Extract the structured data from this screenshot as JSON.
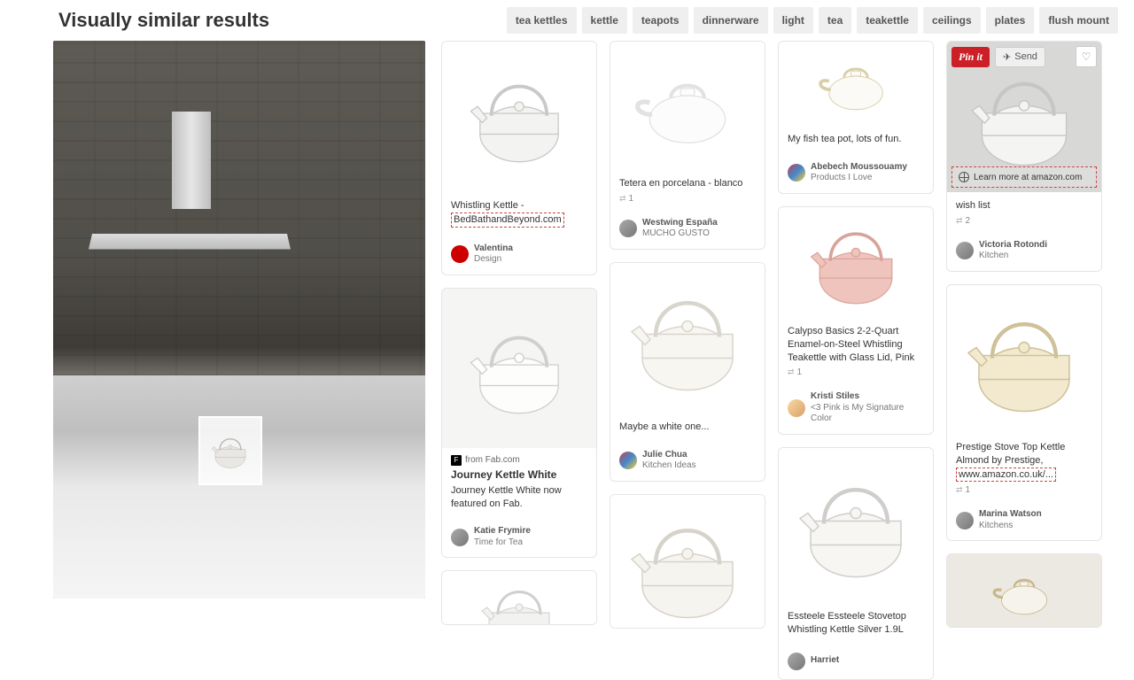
{
  "header": {
    "title": "Visually similar results",
    "tags": [
      "tea kettles",
      "kettle",
      "teapots",
      "dinnerware",
      "light",
      "tea",
      "teakettle",
      "ceilings",
      "plates",
      "flush mount"
    ]
  },
  "actions": {
    "pinit_label": "Pin it",
    "send_label": "Send",
    "learn_more_label": "Learn more at amazon.com"
  },
  "col1": {
    "pin1": {
      "title_a": "Whistling Kettle -",
      "title_b": "BedBathandBeyond.com",
      "user": "Valentina",
      "board": "Design"
    },
    "pin2": {
      "source_prefix": "from Fab.com",
      "source_title": "Journey Kettle White",
      "desc": "Journey Kettle White now featured on Fab.",
      "user": "Katie Frymire",
      "board": "Time for Tea"
    }
  },
  "col2": {
    "pin1": {
      "title": "Tetera en porcelana - blanco",
      "stat": "1",
      "user": "Westwing España",
      "board": "MUCHO GUSTO"
    },
    "pin2": {
      "title": "Maybe a white one...",
      "user": "Julie Chua",
      "board": "Kitchen Ideas"
    }
  },
  "col3": {
    "pin1": {
      "title": "My fish tea pot, lots of fun.",
      "user": "Abebech Moussouamy",
      "board": "Products I Love"
    },
    "pin2": {
      "title": "Calypso Basics 2-2-Quart Enamel-on-Steel Whistling Teakettle with Glass Lid, Pink",
      "stat": "1",
      "user": "Kristi Stiles",
      "board": "<3 Pink is My Signature Color"
    },
    "pin3": {
      "title": "Essteele Essteele Stovetop Whistling Kettle Silver 1.9L",
      "user": "Harriet"
    }
  },
  "col4": {
    "pin1": {
      "title": "wish list",
      "stat": "2",
      "user": "Victoria Rotondi",
      "board": "Kitchen"
    },
    "pin2": {
      "title_a": "Prestige Stove Top Kettle Almond by Prestige,",
      "title_b": "www.amazon.co.uk/...",
      "stat": "1",
      "user": "Marina Watson",
      "board": "Kitchens"
    }
  }
}
